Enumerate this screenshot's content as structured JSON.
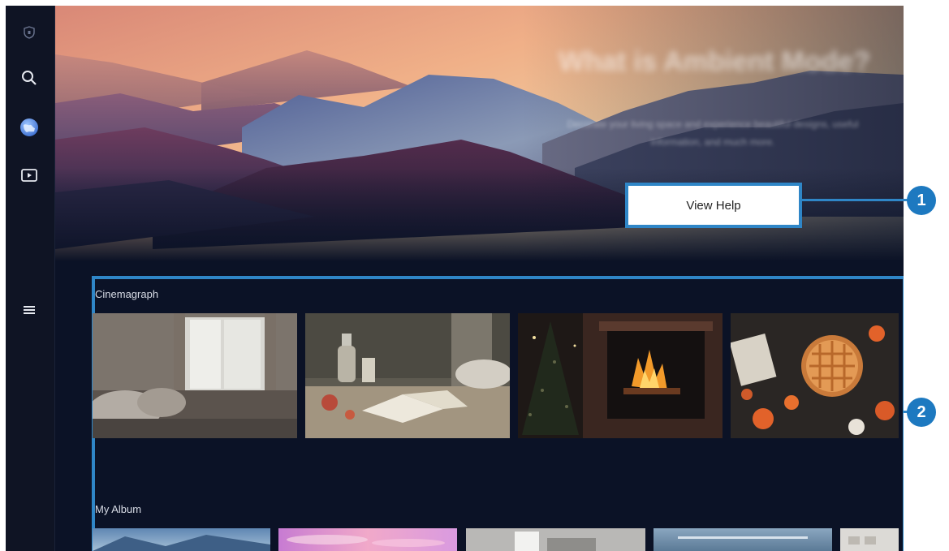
{
  "sidebar": {
    "items": [
      {
        "icon": "shield-icon"
      },
      {
        "icon": "search-icon"
      },
      {
        "icon": "globe-icon"
      },
      {
        "icon": "media-play-icon"
      },
      {
        "icon": "menu-icon"
      }
    ]
  },
  "hero": {
    "title": "What is Ambient Mode?",
    "description": "Decorate your living space and experience beautiful designs, useful information, and much more.",
    "button_label": "View Help"
  },
  "callouts": [
    "1",
    "2"
  ],
  "sections": [
    {
      "label": "Cinemagraph",
      "items": [
        "bedroom-window",
        "reading-table",
        "fireplace",
        "autumn-pie"
      ]
    },
    {
      "label": "My Album",
      "items": [
        "landscape",
        "pink-sky",
        "room",
        "ocean",
        "gallery"
      ]
    }
  ],
  "colors": {
    "accent": "#2f86c7",
    "badge": "#1d79c0",
    "background": "#0b1226"
  }
}
